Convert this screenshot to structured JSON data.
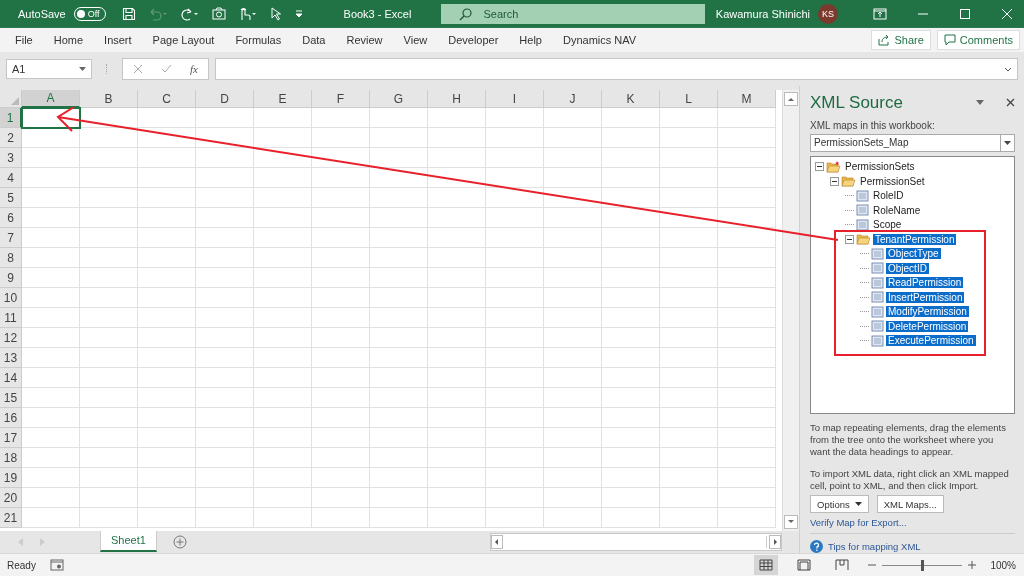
{
  "title_bar": {
    "autosave_label": "AutoSave",
    "autosave": {
      "label": "Off",
      "on": false
    },
    "undo_disabled": true,
    "title": "Book3 - Excel",
    "search": {
      "placeholder": "Search"
    },
    "user_name": "Kawamura Shinichi",
    "user_initials": "KS"
  },
  "ribbon_tabs": [
    {
      "label": "File",
      "selected": false
    },
    {
      "label": "Home",
      "selected": false
    },
    {
      "label": "Insert",
      "selected": false
    },
    {
      "label": "Page Layout",
      "selected": false
    },
    {
      "label": "Formulas",
      "selected": false
    },
    {
      "label": "Data",
      "selected": false
    },
    {
      "label": "Review",
      "selected": false
    },
    {
      "label": "View",
      "selected": false
    },
    {
      "label": "Developer",
      "selected": false
    },
    {
      "label": "Help",
      "selected": false
    },
    {
      "label": "Dynamics NAV",
      "selected": false
    }
  ],
  "ribbon_buttons": {
    "share": "Share",
    "comments": "Comments"
  },
  "formula_bar": {
    "name_box": "A1",
    "function_label": "fx"
  },
  "sheet": {
    "columns": [
      {
        "label": "A",
        "selected": true
      },
      {
        "label": "B",
        "selected": false
      },
      {
        "label": "C",
        "selected": false
      },
      {
        "label": "D",
        "selected": false
      },
      {
        "label": "E",
        "selected": false
      },
      {
        "label": "F",
        "selected": false
      },
      {
        "label": "G",
        "selected": false
      },
      {
        "label": "H",
        "selected": false
      },
      {
        "label": "I",
        "selected": false
      },
      {
        "label": "J",
        "selected": false
      },
      {
        "label": "K",
        "selected": false
      },
      {
        "label": "L",
        "selected": false
      },
      {
        "label": "M",
        "selected": false
      }
    ],
    "rows": [
      {
        "label": "1",
        "selected": true
      },
      {
        "label": "2",
        "selected": false
      },
      {
        "label": "3",
        "selected": false
      },
      {
        "label": "4",
        "selected": false
      },
      {
        "label": "5",
        "selected": false
      },
      {
        "label": "6",
        "selected": false
      },
      {
        "label": "7",
        "selected": false
      },
      {
        "label": "8",
        "selected": false
      },
      {
        "label": "9",
        "selected": false
      },
      {
        "label": "10",
        "selected": false
      },
      {
        "label": "11",
        "selected": false
      },
      {
        "label": "12",
        "selected": false
      },
      {
        "label": "13",
        "selected": false
      },
      {
        "label": "14",
        "selected": false
      },
      {
        "label": "15",
        "selected": false
      },
      {
        "label": "16",
        "selected": false
      },
      {
        "label": "17",
        "selected": false
      },
      {
        "label": "18",
        "selected": false
      },
      {
        "label": "19",
        "selected": false
      },
      {
        "label": "20",
        "selected": false
      },
      {
        "label": "21",
        "selected": false
      }
    ]
  },
  "sheet_tabs": [
    {
      "label": "Sheet1",
      "selected": true
    }
  ],
  "xml_source": {
    "title": "XML Source",
    "maps_label": "XML maps in this workbook:",
    "map": "PermissionSets_Map",
    "tree": [
      {
        "label": "PermissionSets",
        "kind": "root",
        "expanded": true,
        "selected": false,
        "children": [
          {
            "label": "PermissionSet",
            "kind": "folder",
            "expanded": true,
            "selected": false,
            "children": [
              {
                "label": "RoleID",
                "kind": "field",
                "selected": false
              },
              {
                "label": "RoleName",
                "kind": "field",
                "selected": false
              },
              {
                "label": "Scope",
                "kind": "field",
                "selected": false
              },
              {
                "label": "TenantPermission",
                "kind": "folder",
                "expanded": true,
                "selected": true,
                "children": [
                  {
                    "label": "ObjectType",
                    "kind": "field",
                    "selected": true
                  },
                  {
                    "label": "ObjectID",
                    "kind": "field",
                    "selected": true
                  },
                  {
                    "label": "ReadPermission",
                    "kind": "field",
                    "selected": true
                  },
                  {
                    "label": "InsertPermission",
                    "kind": "field",
                    "selected": true
                  },
                  {
                    "label": "ModifyPermission",
                    "kind": "field",
                    "selected": true
                  },
                  {
                    "label": "DeletePermission",
                    "kind": "field",
                    "selected": true
                  },
                  {
                    "label": "ExecutePermission",
                    "kind": "field",
                    "selected": true
                  }
                ]
              }
            ]
          }
        ]
      }
    ],
    "help_text_1": "To map repeating elements, drag the elements from the tree onto the worksheet where you want the data headings to appear.",
    "help_text_2": "To import XML data, right click an XML mapped cell, point to XML, and then click Import.",
    "options_button": "Options",
    "xml_maps_button": "XML Maps...",
    "verify_link": "Verify Map for Export...",
    "tips_link": "Tips for mapping XML"
  },
  "status_bar": {
    "status": "Ready",
    "views": [
      {
        "kind": "normal",
        "selected": true
      },
      {
        "kind": "page_layout",
        "selected": false
      },
      {
        "kind": "page_break",
        "selected": false
      }
    ],
    "zoom": {
      "level": 0.5,
      "label": "100%"
    }
  }
}
